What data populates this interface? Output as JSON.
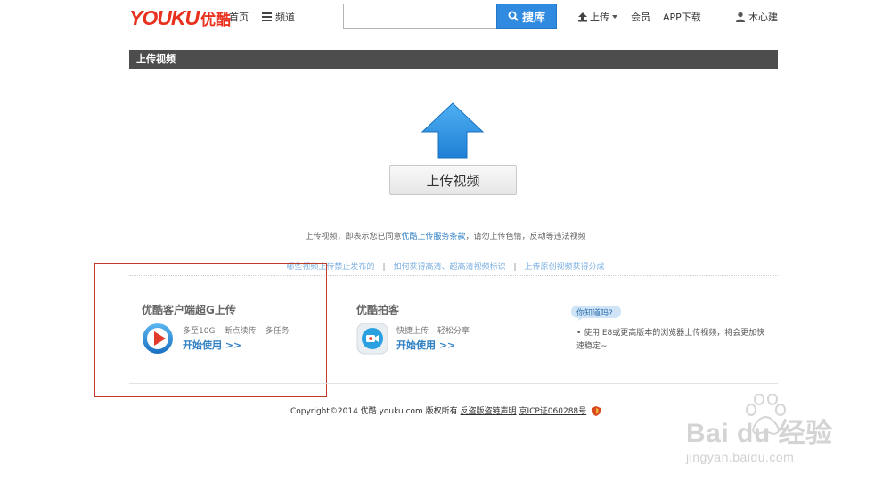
{
  "header": {
    "logo_latin": "YOUKU",
    "logo_cn": "优酷",
    "nav_home": "首页",
    "nav_channel": "频道",
    "search_placeholder": "",
    "search_button": "搜库",
    "upload": "上传",
    "vip": "会员",
    "app_download": "APP下载",
    "username": "木心建"
  },
  "title_bar": "上传视频",
  "upload": {
    "button_label": "上传视频",
    "notice_prefix": "上传视频，即表示您已同意",
    "notice_link": "优酷上传服务条款",
    "notice_suffix": "，请勿上传色情，反动等违法视频"
  },
  "help_links": [
    "哪些视频上传禁止发布的",
    "如何获得高清、超高清视频标识",
    "上传原创视频获得分成"
  ],
  "features": {
    "client": {
      "title": "优酷客户端超G上传",
      "tags": [
        "多至10G",
        "断点续传",
        "多任务"
      ],
      "link": "开始使用 >>"
    },
    "paike": {
      "title": "优酷拍客",
      "tags": [
        "快捷上传",
        "轻松分享"
      ],
      "link": "开始使用 >>"
    }
  },
  "tip": {
    "bubble": "你知道吗?",
    "text": "• 使用IE8或更高版本的浏览器上传视频，将会更加快速稳定~"
  },
  "footer": {
    "copyright": "Copyright©2014 优酷 youku.com 版权所有",
    "link1": "反盗版盗链声明",
    "link2": "京ICP证060288号"
  },
  "watermark": {
    "brand": "Bai du 经验",
    "url": "jingyan.baidu.com"
  },
  "colors": {
    "accent_blue": "#2f8ae0",
    "logo_red": "#e8311e",
    "link_blue": "#2f7fc4",
    "title_bar": "#4d4d4d",
    "annotation_red": "#c0392b"
  }
}
